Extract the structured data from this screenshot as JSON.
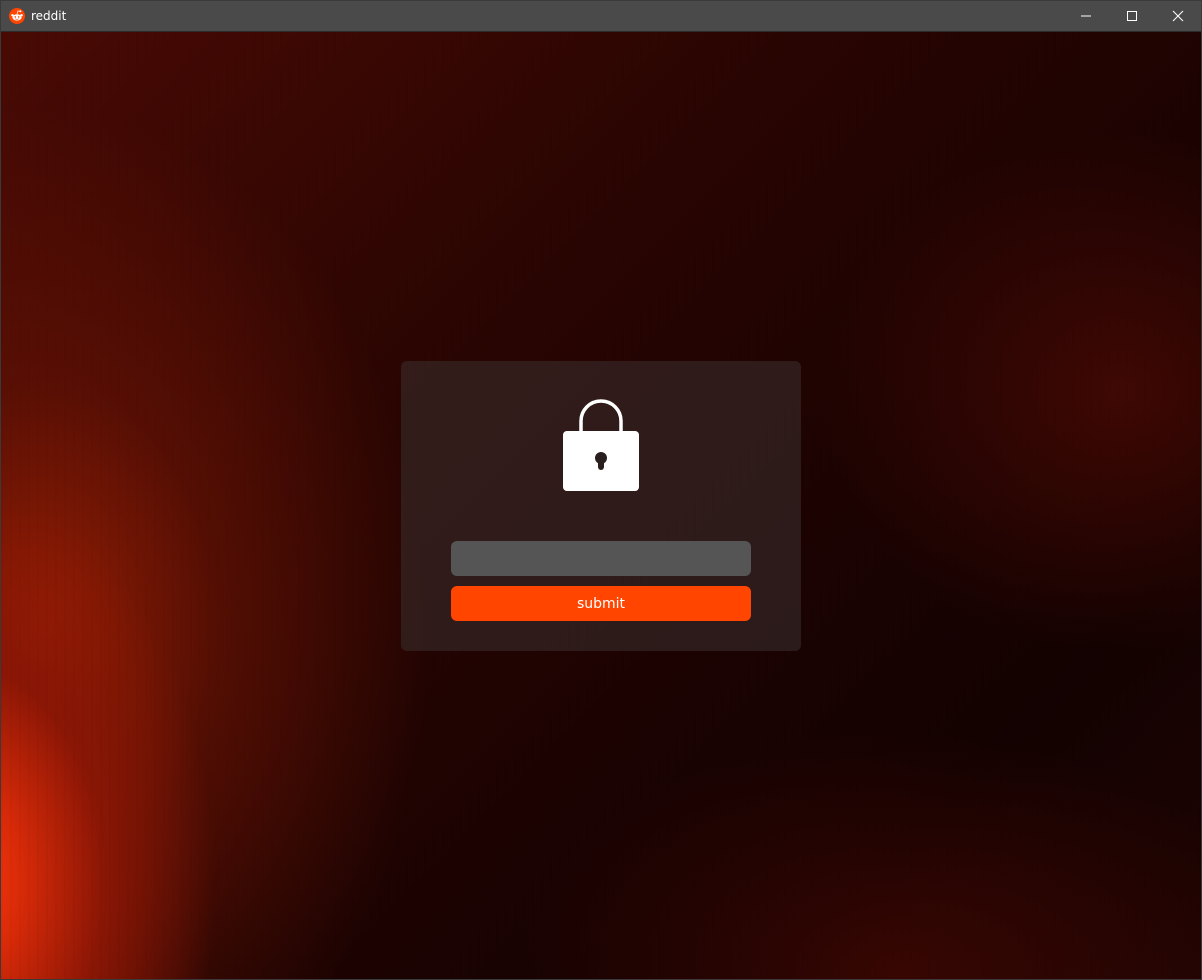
{
  "window": {
    "title": "reddit",
    "app_icon": "reddit-icon",
    "controls": {
      "minimize_icon": "minimize-icon",
      "maximize_icon": "maximize-icon",
      "close_icon": "close-icon"
    }
  },
  "lock_screen": {
    "icon": "lock-icon",
    "password": {
      "value": "",
      "placeholder": ""
    },
    "submit_label": "submit"
  },
  "colors": {
    "accent": "#ff4500",
    "titlebar": "#4a4a4a",
    "input_bg": "#555555"
  }
}
